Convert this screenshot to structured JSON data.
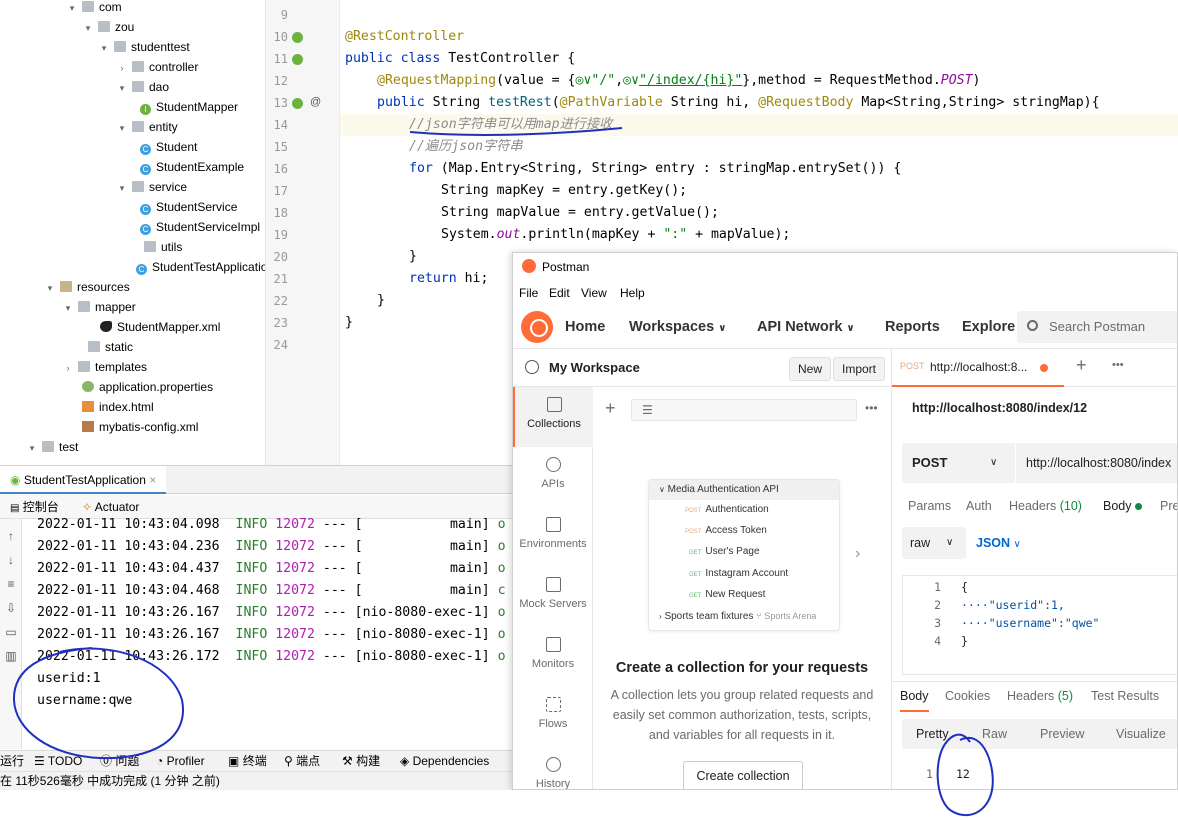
{
  "project_tree": {
    "items": [
      {
        "label": "com",
        "icon": "folder-icon",
        "arrow": "down"
      },
      {
        "label": "zou",
        "icon": "folder-icon",
        "arrow": "down"
      },
      {
        "label": "studenttest",
        "icon": "folder-icon",
        "arrow": "down"
      },
      {
        "label": "controller",
        "icon": "folder-icon",
        "arrow": "right"
      },
      {
        "label": "dao",
        "icon": "folder-icon",
        "arrow": "down"
      },
      {
        "label": "StudentMapper",
        "icon": "interface-icon",
        "arrow": ""
      },
      {
        "label": "entity",
        "icon": "folder-icon",
        "arrow": "down"
      },
      {
        "label": "Student",
        "icon": "class-icon",
        "arrow": ""
      },
      {
        "label": "StudentExample",
        "icon": "class-icon",
        "arrow": ""
      },
      {
        "label": "service",
        "icon": "folder-icon",
        "arrow": "down"
      },
      {
        "label": "StudentService",
        "icon": "class-icon",
        "arrow": ""
      },
      {
        "label": "StudentServiceImpl",
        "icon": "class-icon",
        "arrow": ""
      },
      {
        "label": "utils",
        "icon": "folder-icon",
        "arrow": ""
      },
      {
        "label": "StudentTestApplication",
        "icon": "spring-class-icon",
        "arrow": ""
      },
      {
        "label": "resources",
        "icon": "resources-folder-icon",
        "arrow": "down"
      },
      {
        "label": "mapper",
        "icon": "folder-icon",
        "arrow": "down"
      },
      {
        "label": "StudentMapper.xml",
        "icon": "mybatis-icon",
        "arrow": ""
      },
      {
        "label": "static",
        "icon": "folder-icon",
        "arrow": ""
      },
      {
        "label": "templates",
        "icon": "folder-icon",
        "arrow": "right"
      },
      {
        "label": "application.properties",
        "icon": "properties-icon",
        "arrow": ""
      },
      {
        "label": "index.html",
        "icon": "html-icon",
        "arrow": ""
      },
      {
        "label": "mybatis-config.xml",
        "icon": "xml-icon",
        "arrow": ""
      },
      {
        "label": "test",
        "icon": "folder-icon",
        "arrow": "down"
      }
    ]
  },
  "editor": {
    "line_numbers": [
      "9",
      "10",
      "11",
      "12",
      "13",
      "14",
      "15",
      "16",
      "17",
      "18",
      "19",
      "20",
      "21",
      "22",
      "23",
      "24"
    ],
    "lines": {
      "l10": "@RestController",
      "l11a": "public class ",
      "l11b": "TestController {",
      "l12a": "@RequestMapping",
      "l12b": "(value = {",
      "l12c": "\"/\"",
      "l12d": ",",
      "l12e": "\"/index/{hi}\"",
      "l12f": "},method = RequestMethod.",
      "l12g": "POST",
      "l12h": ")",
      "l13a": "public ",
      "l13b": "String ",
      "l13c": "testRest",
      "l13d": "(",
      "l13e": "@PathVariable",
      "l13f": " String hi, ",
      "l13g": "@RequestBody",
      "l13h": " Map<String,String> stringMap){",
      "l14": "//json字符串可以用map进行接收",
      "l15": "//遍历json字符串",
      "l16a": "for ",
      "l16b": "(Map.Entry<String, String> entry : stringMap.entrySet()) {",
      "l17": "String mapKey = entry.getKey();",
      "l18": "String mapValue = entry.getValue();",
      "l19a": "System.",
      "l19b": "out",
      "l19c": ".println(mapKey + ",
      "l19d": "\":\"",
      "l19e": " + mapValue);",
      "l20": "}",
      "l21a": "return ",
      "l21b": "hi;",
      "l22": "}",
      "l23": "}"
    }
  },
  "run_panel": {
    "tab_label": "StudentTestApplication",
    "subtabs": [
      "控制台",
      "Actuator"
    ],
    "log_lines": [
      {
        "ts": "2022-01-11 10:43:04.098",
        "level": "INFO",
        "pid": "12072",
        "sep": "---",
        "thread": "[           main]",
        "tail": "o"
      },
      {
        "ts": "2022-01-11 10:43:04.236",
        "level": "INFO",
        "pid": "12072",
        "sep": "---",
        "thread": "[           main]",
        "tail": "o"
      },
      {
        "ts": "2022-01-11 10:43:04.437",
        "level": "INFO",
        "pid": "12072",
        "sep": "---",
        "thread": "[           main]",
        "tail": "o"
      },
      {
        "ts": "2022-01-11 10:43:04.468",
        "level": "INFO",
        "pid": "12072",
        "sep": "---",
        "thread": "[           main]",
        "tail": "c"
      },
      {
        "ts": "2022-01-11 10:43:26.167",
        "level": "INFO",
        "pid": "12072",
        "sep": "---",
        "thread": "[nio-8080-exec-1]",
        "tail": "o"
      },
      {
        "ts": "2022-01-11 10:43:26.167",
        "level": "INFO",
        "pid": "12072",
        "sep": "---",
        "thread": "[nio-8080-exec-1]",
        "tail": "o"
      },
      {
        "ts": "2022-01-11 10:43:26.172",
        "level": "INFO",
        "pid": "12072",
        "sep": "---",
        "thread": "[nio-8080-exec-1]",
        "tail": "o"
      }
    ],
    "output_lines": [
      "userid:1",
      "username:qwe"
    ],
    "bottom_tabs": [
      "运行",
      "TODO",
      "问题",
      "Profiler",
      "终端",
      "端点",
      "构建",
      "Dependencies"
    ],
    "status_text": "在 11秒526毫秒 中成功完成 (1 分钟 之前)"
  },
  "postman": {
    "title": "Postman",
    "menu": [
      "File",
      "Edit",
      "View",
      "Help"
    ],
    "nav": {
      "home": "Home",
      "workspaces": "Workspaces",
      "api_network": "API Network",
      "reports": "Reports",
      "explore": "Explore"
    },
    "search_placeholder": "Search Postman",
    "workspace_name": "My Workspace",
    "new_label": "New",
    "import_label": "Import",
    "rail": [
      "Collections",
      "APIs",
      "Environments",
      "Mock Servers",
      "Monitors",
      "Flows",
      "History"
    ],
    "illustration": {
      "folder": "Media Authentication API",
      "requests": [
        {
          "method": "POST",
          "name": "Authentication"
        },
        {
          "method": "POST",
          "name": "Access Token"
        },
        {
          "method": "GET",
          "name": "User's Page"
        },
        {
          "method": "GET",
          "name": "Instagram Account"
        },
        {
          "method": "GET",
          "name": "New Request"
        }
      ],
      "footer_left": "Sports team fixtures",
      "footer_right": "Sports Arena"
    },
    "empty_title": "Create a collection for your requests",
    "empty_desc": "A collection lets you group related requests and easily set common authorization, tests, scripts, and variables for all requests in it.",
    "create_collection": "Create collection",
    "request": {
      "tab_method": "POST",
      "tab_url": "http://localhost:8...",
      "url_title": "http://localhost:8080/index/12",
      "method": "POST",
      "url": "http://localhost:8080/index",
      "subtabs": {
        "params": "Params",
        "auth": "Auth",
        "headers": "Headers",
        "headers_count": "(10)",
        "body": "Body",
        "pre": "Pre"
      },
      "body_mode": "raw",
      "body_lang": "JSON",
      "body_lines": [
        "{",
        "····\"userid\":1,",
        "····\"username\":\"qwe\"",
        "}"
      ],
      "body_line_numbers": [
        "1",
        "2",
        "3",
        "4"
      ]
    },
    "response": {
      "tabs": [
        "Body",
        "Cookies",
        "Headers",
        "(5)",
        "Test Results"
      ],
      "views": [
        "Pretty",
        "Raw",
        "Preview",
        "Visualize"
      ],
      "line_number": "1",
      "value": "12"
    }
  }
}
